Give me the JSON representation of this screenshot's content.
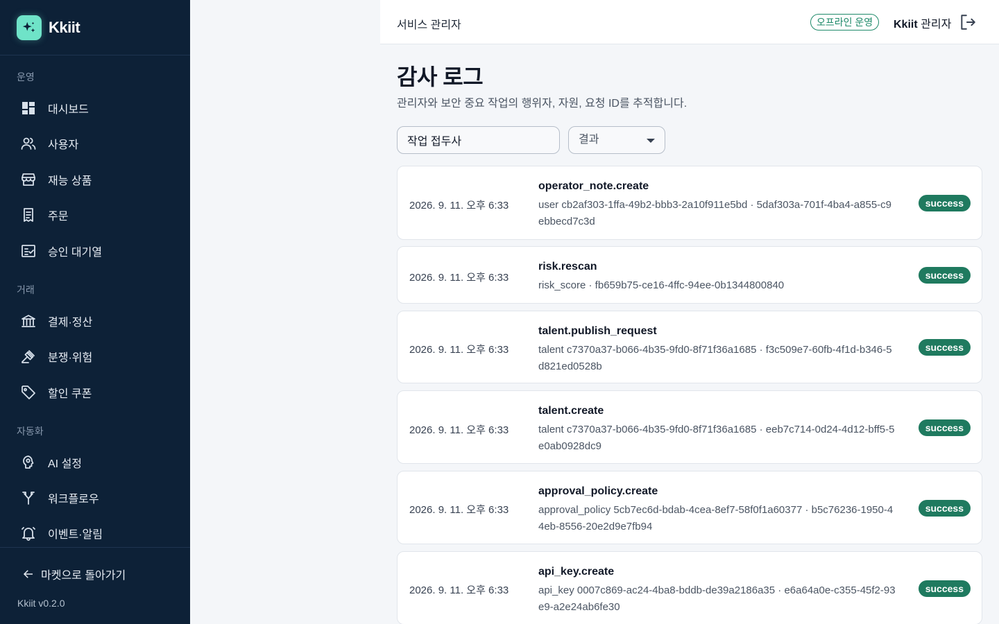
{
  "brand": {
    "name": "Kkiit"
  },
  "sidebar": {
    "sections": [
      {
        "label": "운영"
      },
      {
        "label": "거래"
      },
      {
        "label": "자동화"
      }
    ],
    "items": [
      {
        "label": "대시보드",
        "icon": "dashboard-icon"
      },
      {
        "label": "사용자",
        "icon": "users-icon"
      },
      {
        "label": "재능 상품",
        "icon": "store-icon"
      },
      {
        "label": "주문",
        "icon": "receipt-icon"
      },
      {
        "label": "승인 대기열",
        "icon": "checklist-icon"
      },
      {
        "label": "결제·정산",
        "icon": "bank-icon"
      },
      {
        "label": "분쟁·위험",
        "icon": "gavel-icon"
      },
      {
        "label": "할인 쿠폰",
        "icon": "tag-icon"
      },
      {
        "label": "AI 설정",
        "icon": "ai-brain-icon"
      },
      {
        "label": "워크플로우",
        "icon": "workflow-icon"
      },
      {
        "label": "이벤트·알림",
        "icon": "bell-icon"
      }
    ],
    "back_label": "마켓으로 돌아가기",
    "version": "Kkiit v0.2.0"
  },
  "header": {
    "title": "서비스 관리자",
    "mode_badge": "오프라인 운영",
    "admin_brand": "Kkiit",
    "admin_role": "관리자"
  },
  "main": {
    "title": "감사 로그",
    "subtitle": "관리자와 보안 중요 작업의 행위자, 자원, 요청 ID를 추적합니다.",
    "search_value": "작업 접두사",
    "result_filter": "결과"
  },
  "logs": [
    {
      "time": "2026. 9. 11. 오후 6:33",
      "action": "operator_note.create",
      "detail": "user cb2af303-1ffa-49b2-bbb3-2a10f911e5bd · 5daf303a-701f-4ba4-a855-c9ebbecd7c3d",
      "status": "success"
    },
    {
      "time": "2026. 9. 11. 오후 6:33",
      "action": "risk.rescan",
      "detail": "risk_score · fb659b75-ce16-4ffc-94ee-0b1344800840",
      "status": "success"
    },
    {
      "time": "2026. 9. 11. 오후 6:33",
      "action": "talent.publish_request",
      "detail": "talent c7370a37-b066-4b35-9fd0-8f71f36a1685 · f3c509e7-60fb-4f1d-b346-5d821ed0528b",
      "status": "success"
    },
    {
      "time": "2026. 9. 11. 오후 6:33",
      "action": "talent.create",
      "detail": "talent c7370a37-b066-4b35-9fd0-8f71f36a1685 · eeb7c714-0d24-4d12-bff5-5e0ab0928dc9",
      "status": "success"
    },
    {
      "time": "2026. 9. 11. 오후 6:33",
      "action": "approval_policy.create",
      "detail": "approval_policy 5cb7ec6d-bdab-4cea-8ef7-58f0f1a60377 · b5c76236-1950-44eb-8556-20e2d9e7fb94",
      "status": "success"
    },
    {
      "time": "2026. 9. 11. 오후 6:33",
      "action": "api_key.create",
      "detail": "api_key 0007c869-ac24-4ba8-bddb-de39a2186a35 · e6a64a0e-c355-45f2-93e9-a2e24ab6fe30",
      "status": "success"
    }
  ],
  "colors": {
    "sidebar_bg": "#0d2137",
    "accent": "#6fe3c8",
    "success": "#1f7a5f"
  }
}
